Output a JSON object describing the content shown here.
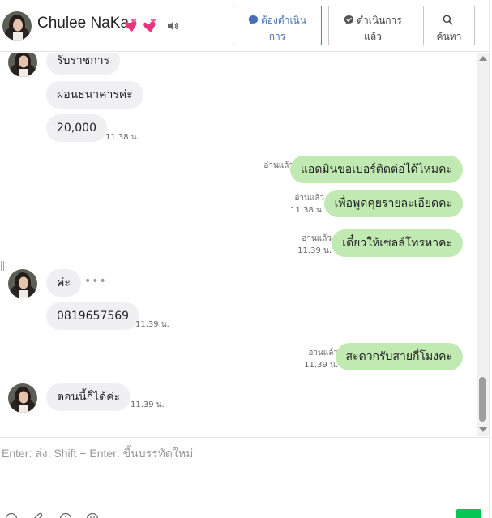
{
  "header": {
    "contact_name": "Chulee NaKa",
    "buttons": [
      {
        "line1": "ต้องดำเนิน",
        "line2": "การ",
        "icon": "chat-bubble-icon"
      },
      {
        "line1": "ดำเนินการ",
        "line2": "แล้ว",
        "icon": "chat-check-icon"
      },
      {
        "line1": "",
        "line2": "ค้นหา",
        "icon": "search-icon"
      }
    ]
  },
  "messages": [
    {
      "dir": "in",
      "text": "รับราชการ"
    },
    {
      "dir": "in",
      "text": "ผ่อนธนาคารค่ะ"
    },
    {
      "dir": "in",
      "text": "20,000",
      "time": "11.38 น."
    },
    {
      "dir": "out",
      "text": "แอดมินขอเบอร์ติดต่อได้ไหมคะ",
      "read": "อ่านแล้ว"
    },
    {
      "dir": "out",
      "text": "เพื่อพูดคุยรายละเอียดคะ",
      "read": "อ่านแล้ว",
      "time": "11.38 น."
    },
    {
      "dir": "out",
      "text": "เดี๋ยวให้เซลล์โทรหาคะ",
      "read": "อ่านแล้ว",
      "time": "11.39 น."
    },
    {
      "dir": "in",
      "text": "ค่ะ",
      "extra": "•••"
    },
    {
      "dir": "in",
      "text": "0819657569",
      "time": "11.39 น."
    },
    {
      "dir": "out",
      "text": "สะดวกรับสายกี่โมงคะ",
      "read": "อ่านแล้ว",
      "time": "11.39 น."
    },
    {
      "dir": "in",
      "text": "ตอนนี้ก็ได้ค่ะ",
      "time": "11.39 น."
    }
  ],
  "composer": {
    "placeholder": "Enter: ส่ง, Shift + Enter: ขึ้นบรรทัดใหม่"
  },
  "colors": {
    "outgoing_bubble": "#c1eab3",
    "incoming_bubble": "#f0f0f3",
    "send_button": "#06c755",
    "primary_button_text": "#4a6fb5"
  }
}
